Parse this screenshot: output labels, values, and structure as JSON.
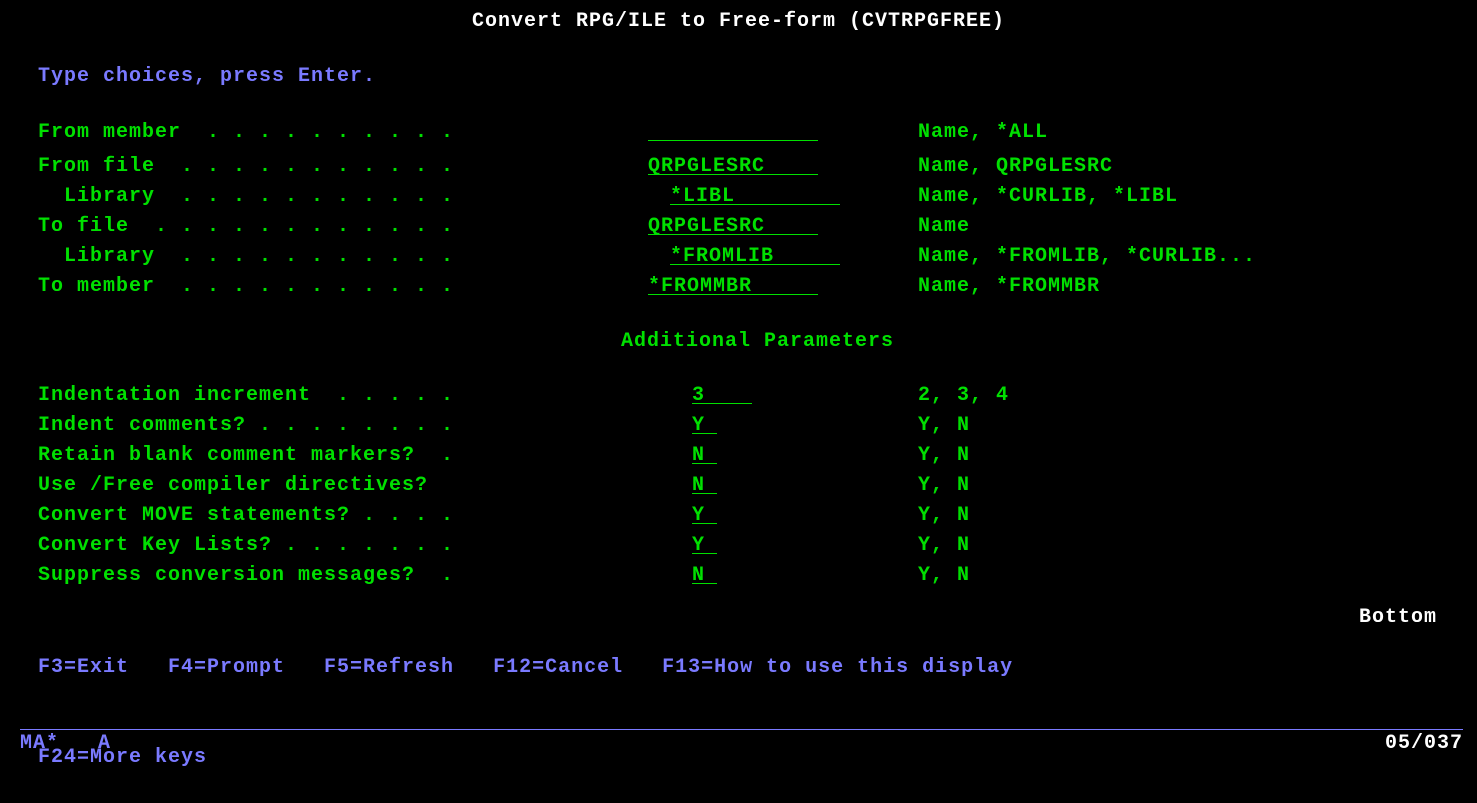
{
  "title": "Convert RPG/ILE to Free-form (CVTRPGFREE)",
  "instruction": "Type choices, press Enter.",
  "params": {
    "from_member": {
      "label": "From member  . . . . . . . . . .",
      "value": "",
      "choices": "Name, *ALL"
    },
    "from_file": {
      "label": "From file  . . . . . . . . . . .",
      "value": "QRPGLESRC",
      "choices": "Name, QRPGLESRC"
    },
    "from_lib": {
      "label": "  Library  . . . . . . . . . . .",
      "value": "*LIBL",
      "choices": "Name, *CURLIB, *LIBL"
    },
    "to_file": {
      "label": "To file  . . . . . . . . . . . .",
      "value": "QRPGLESRC",
      "choices": "Name"
    },
    "to_lib": {
      "label": "  Library  . . . . . . . . . . .",
      "value": "*FROMLIB",
      "choices": "Name, *FROMLIB, *CURLIB..."
    },
    "to_member": {
      "label": "To member  . . . . . . . . . . .",
      "value": "*FROMMBR",
      "choices": "Name, *FROMMBR"
    }
  },
  "addl_header": "Additional Parameters",
  "addl": {
    "indent_incr": {
      "label": "Indentation increment  . . . . .",
      "value": "3",
      "choices": "2, 3, 4"
    },
    "indent_cmt": {
      "label": "Indent comments? . . . . . . . .",
      "value": "Y",
      "choices": "Y, N"
    },
    "retain_blank": {
      "label": "Retain blank comment markers?  .",
      "value": "N",
      "choices": "Y, N"
    },
    "use_free": {
      "label": "Use /Free compiler directives?  ",
      "value": "N",
      "choices": "Y, N"
    },
    "convert_move": {
      "label": "Convert MOVE statements? . . . .",
      "value": "Y",
      "choices": "Y, N"
    },
    "convert_klist": {
      "label": "Convert Key Lists? . . . . . . .",
      "value": "Y",
      "choices": "Y, N"
    },
    "suppress_msg": {
      "label": "Suppress conversion messages?  .",
      "value": "N",
      "choices": "Y, N"
    }
  },
  "bottom_marker": "Bottom",
  "fkeys_line1": "F3=Exit   F4=Prompt   F5=Refresh   F12=Cancel   F13=How to use this display",
  "fkeys_line2": "F24=More keys",
  "status": {
    "left": "MA*   A",
    "right": "05/037"
  }
}
